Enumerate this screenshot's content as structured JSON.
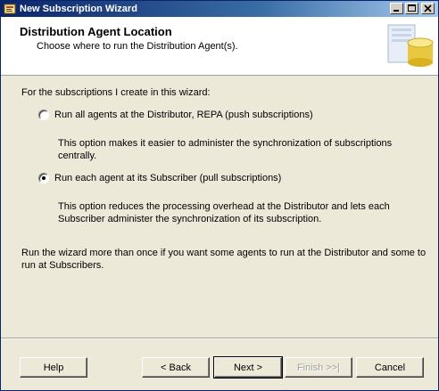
{
  "window": {
    "title": "New Subscription Wizard",
    "controls": [
      "minimize-icon",
      "maximize-icon",
      "close-icon"
    ]
  },
  "header": {
    "title": "Distribution Agent Location",
    "subtitle": "Choose where to run the Distribution Agent(s).",
    "icon": "database-wizard-icon"
  },
  "content": {
    "prompt": "For the subscriptions I create in this wizard:",
    "options": [
      {
        "label": "Run all agents at the Distributor, REPA (push subscriptions)",
        "selected": false,
        "description": "This option makes it easier to administer the synchronization of subscriptions centrally."
      },
      {
        "label": "Run each agent at its Subscriber (pull subscriptions)",
        "selected": true,
        "description": "This option reduces the processing overhead at the Distributor and lets each Subscriber administer the synchronization of its subscription."
      }
    ],
    "note": "Run the wizard more than once if you want some agents to run at the Distributor and some to run at Subscribers."
  },
  "buttons": {
    "help": "Help",
    "back": "< Back",
    "next": "Next >",
    "finish": "Finish >>|",
    "cancel": "Cancel"
  },
  "colors": {
    "titlebar_start": "#0a246a",
    "titlebar_end": "#a6caf0",
    "dialog_face": "#ece9d8"
  }
}
